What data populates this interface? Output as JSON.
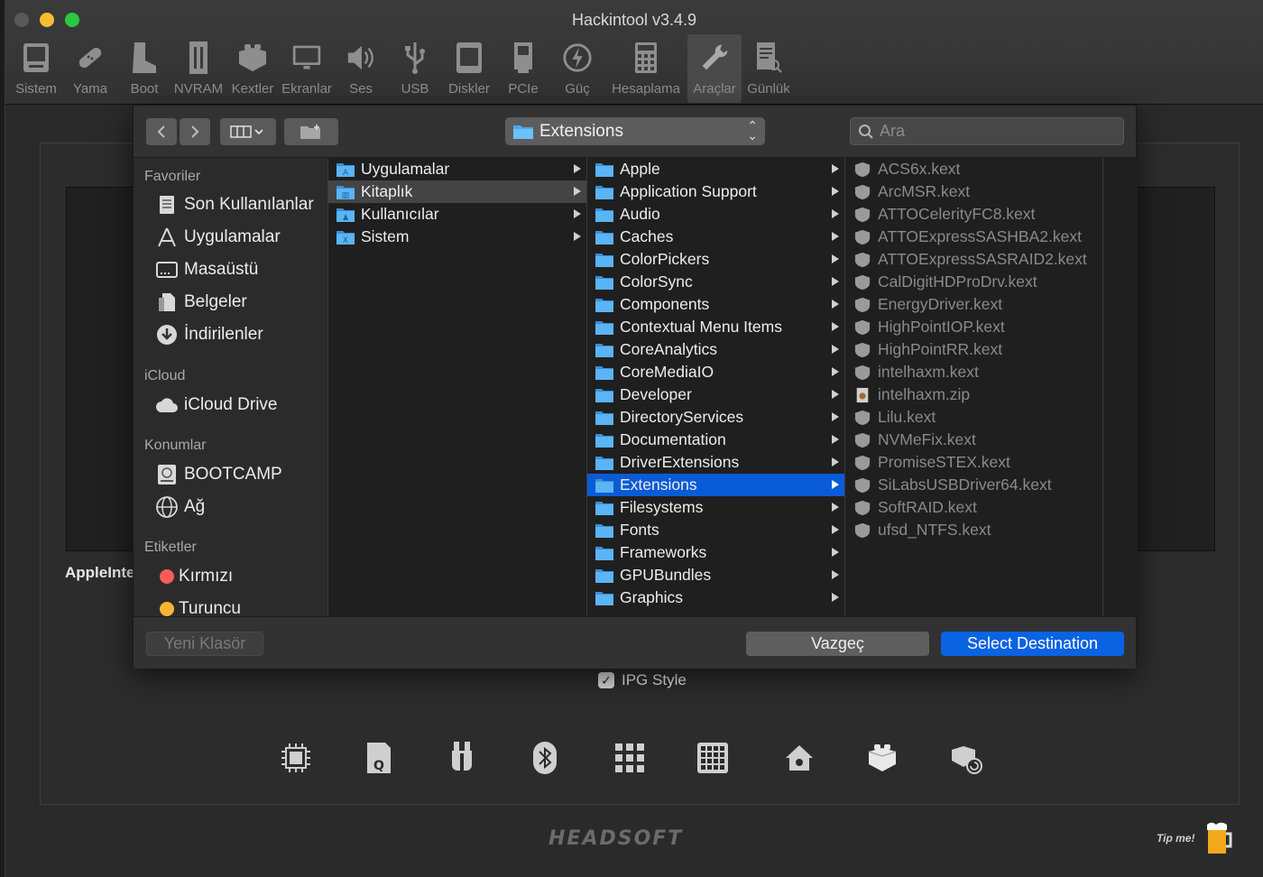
{
  "window": {
    "title": "Hackintool v3.4.9"
  },
  "toolbar": [
    {
      "label": "Sistem",
      "icon": "computer-icon"
    },
    {
      "label": "Yama",
      "icon": "bandage-icon"
    },
    {
      "label": "Boot",
      "icon": "boot-icon"
    },
    {
      "label": "NVRAM",
      "icon": "memory-icon"
    },
    {
      "label": "Kextler",
      "icon": "lego-icon"
    },
    {
      "label": "Ekranlar",
      "icon": "display-icon"
    },
    {
      "label": "Ses",
      "icon": "speaker-icon"
    },
    {
      "label": "USB",
      "icon": "usb-icon"
    },
    {
      "label": "Diskler",
      "icon": "disk-icon"
    },
    {
      "label": "PCIe",
      "icon": "pcie-icon"
    },
    {
      "label": "Güç",
      "icon": "power-icon"
    },
    {
      "label": "Hesaplama",
      "icon": "calculator-icon"
    },
    {
      "label": "Araçlar",
      "icon": "wrench-icon"
    },
    {
      "label": "Günlük",
      "icon": "log-icon"
    }
  ],
  "main": {
    "side_label": "AppleInte",
    "ipg_label": "IPG Style",
    "brand": "HEADSOFT",
    "tip": "Tip me!"
  },
  "dialog": {
    "path": "Extensions",
    "search_placeholder": "Ara",
    "sidebar": {
      "favorites_head": "Favoriler",
      "favorites": [
        "Son Kullanılanlar",
        "Uygulamalar",
        "Masaüstü",
        "Belgeler",
        "İndirilenler"
      ],
      "icloud_head": "iCloud",
      "icloud": [
        "iCloud Drive"
      ],
      "locations_head": "Konumlar",
      "locations": [
        "BOOTCAMP",
        "Ağ"
      ],
      "tags_head": "Etiketler",
      "tags": [
        {
          "label": "Kırmızı",
          "color": "#ff5b5b"
        },
        {
          "label": "Turuncu",
          "color": "#f6b534"
        }
      ]
    },
    "col1": [
      "Uygulamalar",
      "Kitaplık",
      "Kullanıcılar",
      "Sistem"
    ],
    "col2": [
      "Apple",
      "Application Support",
      "Audio",
      "Caches",
      "ColorPickers",
      "ColorSync",
      "Components",
      "Contextual Menu Items",
      "CoreAnalytics",
      "CoreMediaIO",
      "Developer",
      "DirectoryServices",
      "Documentation",
      "DriverExtensions",
      "Extensions",
      "Filesystems",
      "Fonts",
      "Frameworks",
      "GPUBundles",
      "Graphics"
    ],
    "col3": [
      "ACS6x.kext",
      "ArcMSR.kext",
      "ATTOCelerityFC8.kext",
      "ATTOExpressSASHBA2.kext",
      "ATTOExpressSASRAID2.kext",
      "CalDigitHDProDrv.kext",
      "EnergyDriver.kext",
      "HighPointIOP.kext",
      "HighPointRR.kext",
      "intelhaxm.kext",
      "intelhaxm.zip",
      "Lilu.kext",
      "NVMeFix.kext",
      "PromiseSTEX.kext",
      "SiLabsUSBDriver64.kext",
      "SoftRAID.kext",
      "ufsd_NTFS.kext"
    ],
    "footer": {
      "new_folder": "Yeni Klasör",
      "cancel": "Vazgeç",
      "confirm": "Select Destination"
    }
  },
  "colors": {
    "accent": "#0a63e2",
    "selection": "#0a5bd6",
    "folder": "#4aa8f0"
  }
}
